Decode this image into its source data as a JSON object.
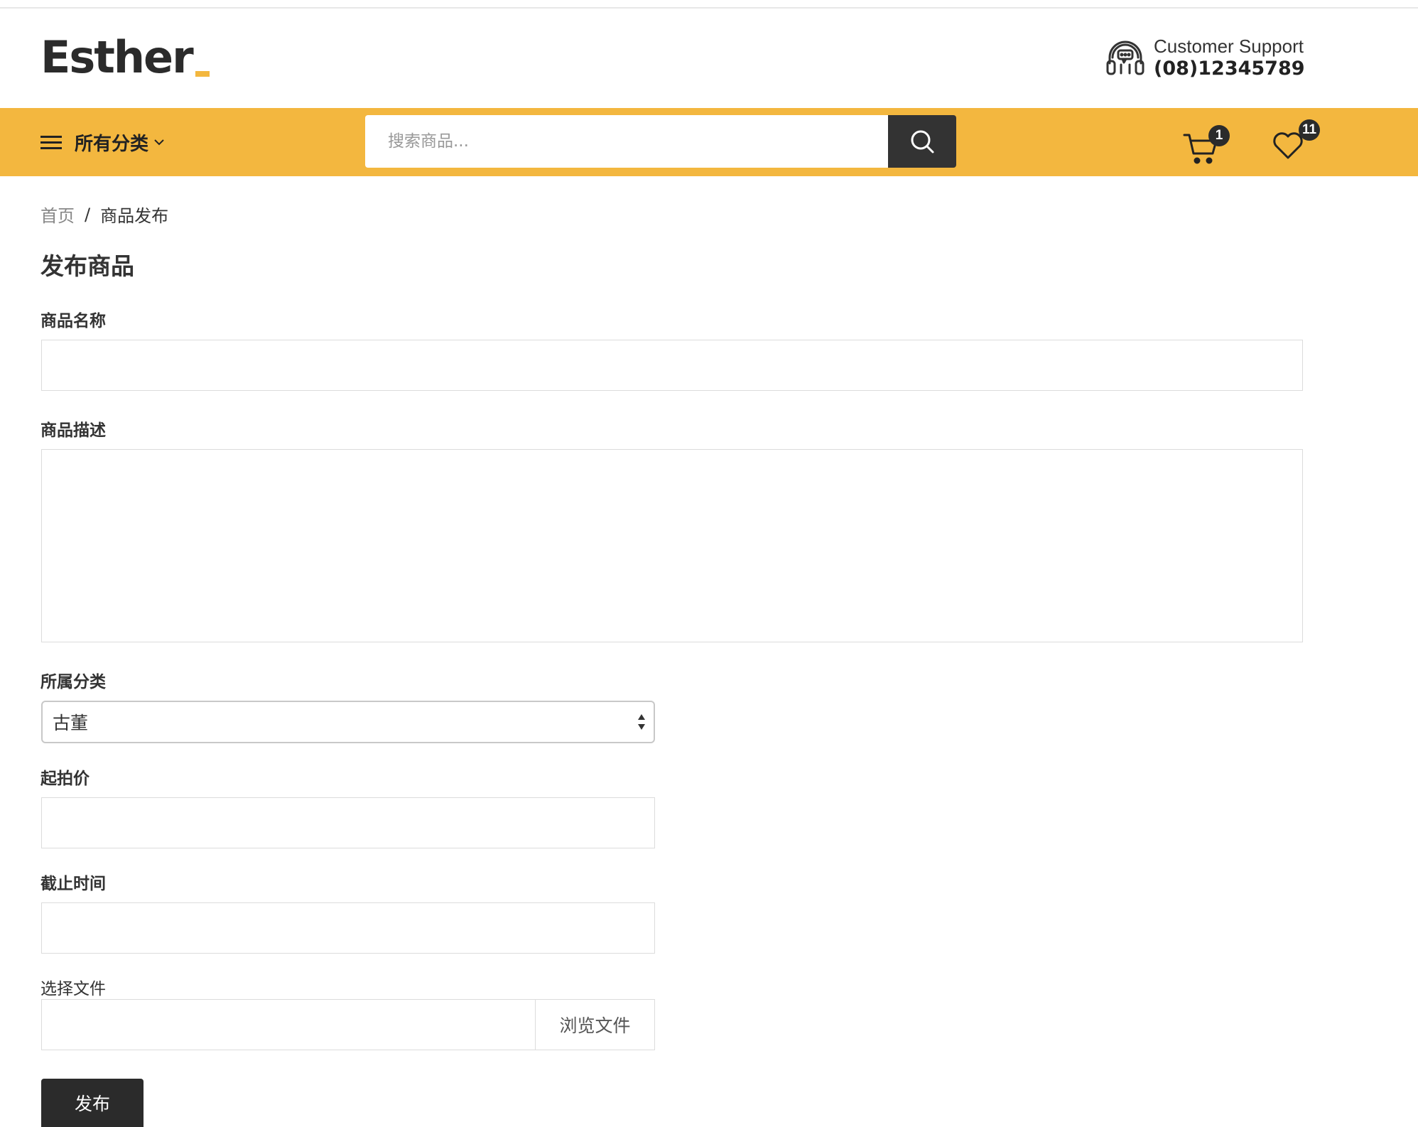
{
  "header": {
    "logo_text": "Esther",
    "support_label": "Customer Support",
    "support_phone": "(08)12345789"
  },
  "nav": {
    "all_categories_label": "所有分类",
    "search_placeholder": "搜索商品...",
    "cart_count": "1",
    "wishlist_count": "11",
    "bar_color": "#f3b73f"
  },
  "breadcrumb": {
    "home": "首页",
    "separator": "/",
    "current": "商品发布"
  },
  "form": {
    "title": "发布商品",
    "name_label": "商品名称",
    "description_label": "商品描述",
    "category_label": "所属分类",
    "category_value": "古董",
    "start_price_label": "起拍价",
    "deadline_label": "截止时间",
    "file_label": "选择文件",
    "browse_label": "浏览文件",
    "submit_label": "发布"
  },
  "icons": {
    "menu": "hamburger-icon",
    "dropdown": "chevron-down-icon",
    "search": "search-icon",
    "cart": "cart-icon",
    "wishlist": "heart-icon",
    "support": "headset-icon"
  }
}
